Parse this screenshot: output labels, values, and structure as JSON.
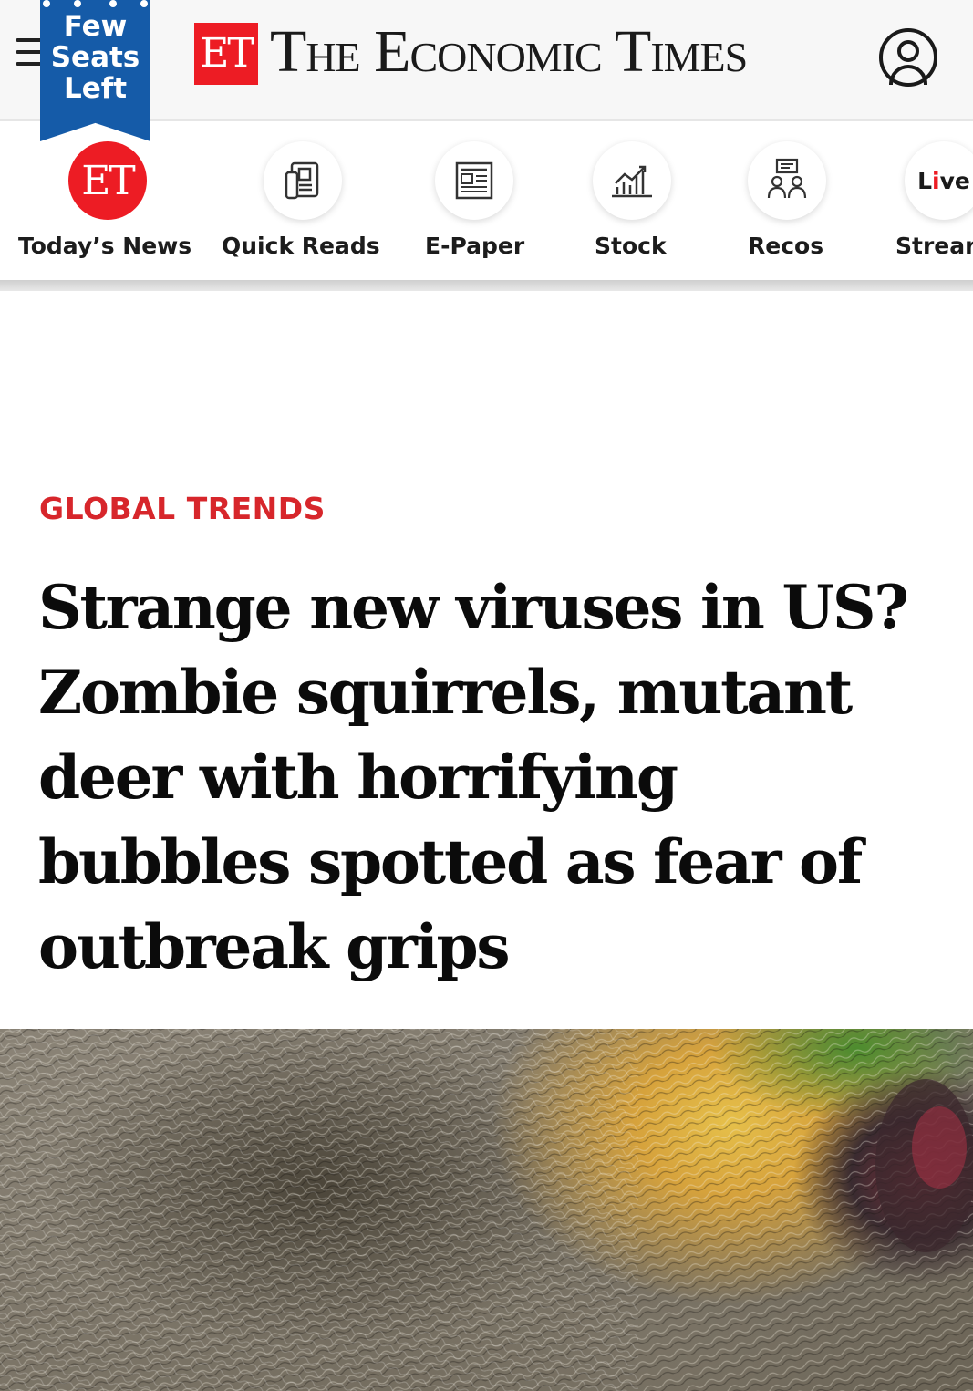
{
  "header": {
    "menu_icon": "hamburger-menu-icon",
    "promo": {
      "lines": [
        "Few",
        "Seats",
        "Left"
      ],
      "color": "#155ba8"
    },
    "logo_box": "ET",
    "masthead": "The Economic Times",
    "user_icon": "user-account-icon",
    "brand_color": "#ed1c24"
  },
  "quicknav": {
    "items": [
      {
        "label": "Today’s News",
        "icon": "et-logo-icon",
        "badge": "ET"
      },
      {
        "label": "Quick Reads",
        "icon": "quick-reads-icon"
      },
      {
        "label": "E-Paper",
        "icon": "newspaper-icon"
      },
      {
        "label": "Stock",
        "icon": "stock-chart-icon"
      },
      {
        "label": "Recos",
        "icon": "recos-people-icon"
      },
      {
        "label": "Strear",
        "icon": "live-stream-icon",
        "badge_prefix": "L",
        "badge_accent": "i",
        "badge_suffix": "ve"
      }
    ]
  },
  "article": {
    "category": "GLOBAL TRENDS",
    "category_color": "#d7262b",
    "headline_lines": [
      "Strange new viruses in US?",
      "Zombie squirrels, mutant",
      "deer with horrifying",
      "bubbles spotted as fear of",
      "outbreak grips"
    ],
    "hero_image": "squirrel-with-lesion-photo"
  }
}
